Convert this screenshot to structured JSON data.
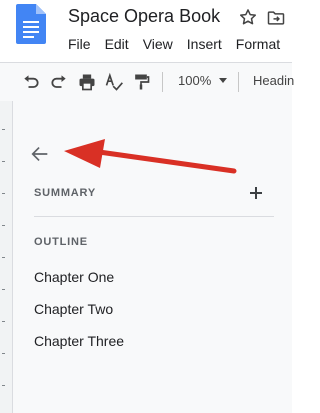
{
  "app": {
    "doc_title": "Space Opera Book",
    "menu": [
      "File",
      "Edit",
      "View",
      "Insert",
      "Format"
    ]
  },
  "toolbar": {
    "zoom": "100%",
    "style": "Headin"
  },
  "panel": {
    "summary_label": "SUMMARY",
    "outline_label": "OUTLINE",
    "headings": [
      "Chapter One",
      "Chapter Two",
      "Chapter Three"
    ]
  },
  "colors": {
    "docs_blue": "#4285f4",
    "annotation_red": "#d93025"
  },
  "icons": [
    "docs-logo-icon",
    "star-icon",
    "move-to-folder-icon",
    "undo-icon",
    "redo-icon",
    "print-icon",
    "spellcheck-icon",
    "paint-format-icon",
    "back-arrow-icon",
    "add-icon"
  ]
}
